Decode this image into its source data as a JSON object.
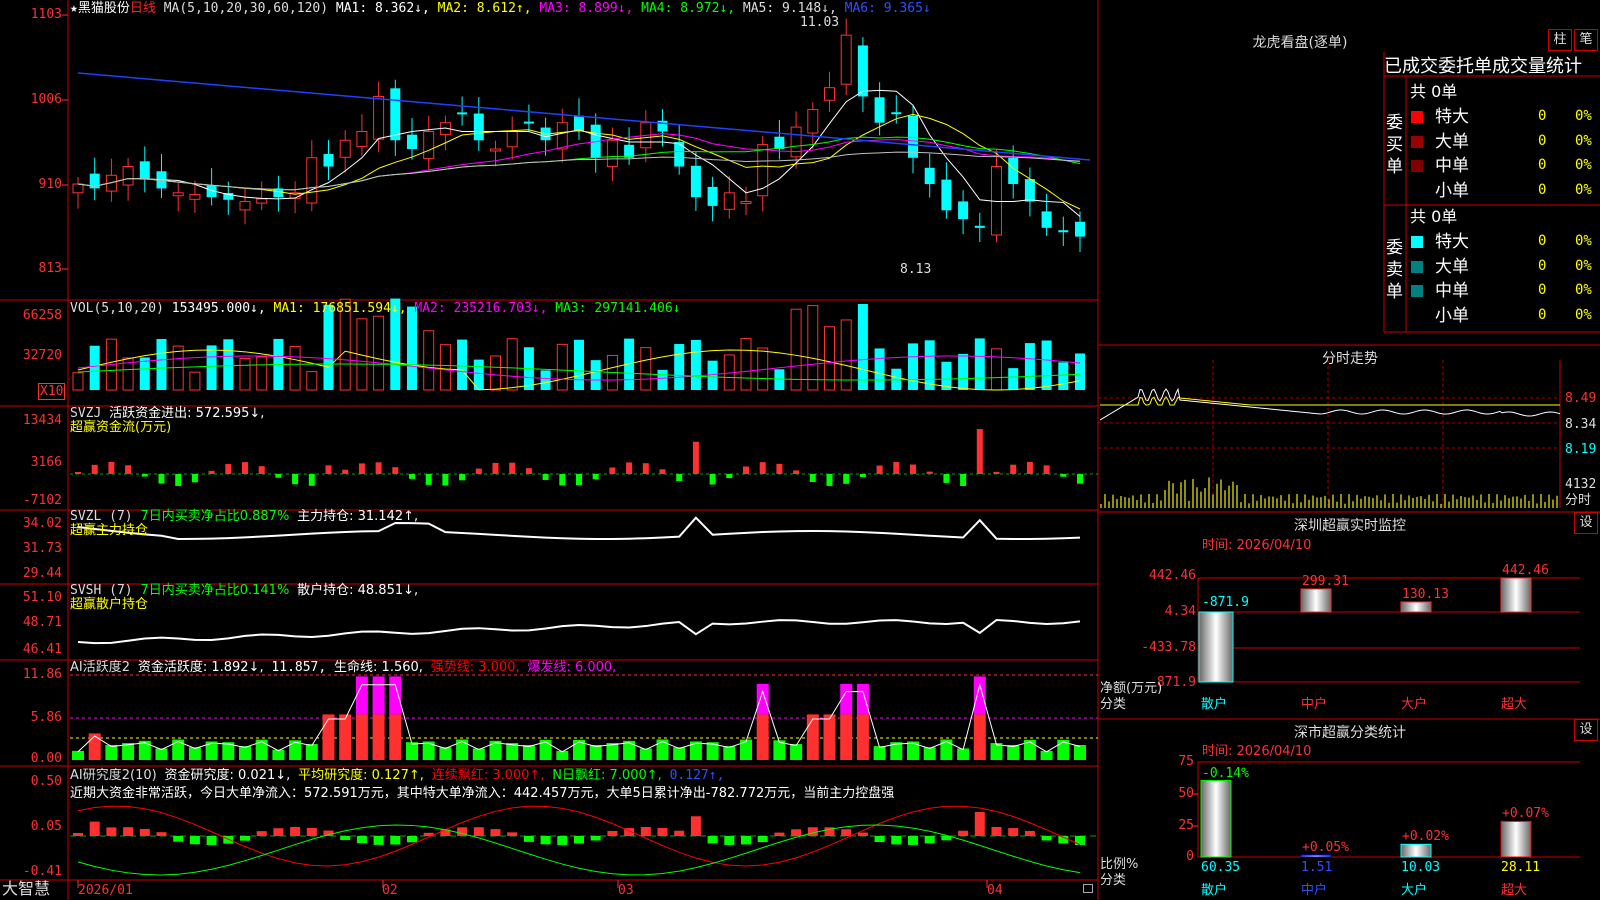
{
  "header": {
    "star": "★",
    "stock_name": "黑猫股份",
    "period": "日线",
    "ma_label": "MA(5,10,20,30,60,120)",
    "ma1": "MA1: 8.362↓,",
    "ma2": "MA2: 8.612↑,",
    "ma3": "MA3: 8.899↓,",
    "ma4": "MA4: 8.972↓,",
    "ma5": "MA5: 9.148↓,",
    "ma6": "MA6: 9.365↓"
  },
  "price_axis": [
    "1103",
    "1006",
    "910",
    "813"
  ],
  "price_marks": {
    "high": "11.03",
    "low": "8.13"
  },
  "vol": {
    "label": "VOL(5,10,20)",
    "value": "153495.000↓,",
    "ma1": "MA1: 176851.594↓,",
    "ma2": "MA2: 235216.703↓,",
    "ma3": "MA3: 297141.406↓",
    "axis": [
      "66258",
      "32720"
    ],
    "unit": "X10"
  },
  "svzj": {
    "label": "SVZJ",
    "value": "活跃资金进出: 572.595↓,",
    "sub": "超赢资金流(万元)",
    "axis": [
      "13434",
      "3166",
      "-7102"
    ]
  },
  "svzl": {
    "label": "SVZL (7)",
    "value": "7日内买卖净占比0.887%",
    "hold": "主力持仓: 31.142↑,",
    "sub": "超赢主力持仓",
    "axis": [
      "34.02",
      "31.73",
      "29.44"
    ]
  },
  "svsh": {
    "label": "SVSH (7)",
    "value": "7日内买卖净占比0.141%",
    "hold": "散户持仓: 48.851↓,",
    "sub": "超赢散户持仓",
    "axis": [
      "51.10",
      "48.71",
      "46.41"
    ]
  },
  "ai_active": {
    "label": "AI活跃度2",
    "v1": "资金活跃度: 1.892↓,",
    "v2": "11.857,",
    "v3": "生命线: 1.560,",
    "v4": "强势线: 3.000,",
    "v5": "爆发线: 6.000,",
    "axis": [
      "11.86",
      "5.86",
      "0.00"
    ]
  },
  "ai_research": {
    "label": "AI研究度2(10)",
    "v1": "资金研究度: 0.021↓,",
    "v2": "平均研究度: 0.127↑,",
    "v3": "连续飘红: 3.000↑,",
    "v4": "N日飘红: 7.000↑,",
    "v5": "0.127↑,",
    "comment": "近期大资金非常活跃，今日大单净流入：572.591万元，其中特大单净流入：442.457万元，大单5日累计净出-782.772万元，当前主力控盘强",
    "axis": [
      "0.50",
      "0.05",
      "-0.41"
    ]
  },
  "bottom": {
    "brand": "大智慧",
    "dates": [
      "2026/01",
      "02",
      "03",
      "04"
    ]
  },
  "sidebar": {
    "dragon_title": "龙虎看盘(逐单)",
    "btn_pillar": "柱",
    "btn_pen": "笔",
    "stat_title": "已成交委托单成交量统计",
    "buy_total": "共 0单",
    "buy_side": "委买单",
    "sell_total": "共 0单",
    "sell_side": "委卖单",
    "rows_buy": [
      {
        "name": "特大",
        "qty": "0",
        "pct": "0%",
        "color": "#ff0000"
      },
      {
        "name": "大单",
        "qty": "0",
        "pct": "0%",
        "color": "#990000"
      },
      {
        "name": "中单",
        "qty": "0",
        "pct": "0%",
        "color": "#800000"
      },
      {
        "name": "小单",
        "qty": "0",
        "pct": "0%",
        "color": ""
      }
    ],
    "rows_sell": [
      {
        "name": "特大",
        "qty": "0",
        "pct": "0%",
        "color": "#00ffff"
      },
      {
        "name": "大单",
        "qty": "0",
        "pct": "0%",
        "color": "#008080"
      },
      {
        "name": "中单",
        "qty": "0",
        "pct": "0%",
        "color": "#008080"
      },
      {
        "name": "小单",
        "qty": "0",
        "pct": "0%",
        "color": ""
      }
    ],
    "timeshare_title": "分时走势",
    "timeshare_axis": [
      "8.49",
      "8.34",
      "8.19"
    ],
    "timeshare_vol": "4132",
    "timeshare_unit": "分时",
    "monitor_title": "深圳超赢实时监控",
    "monitor_btn": "设",
    "monitor_time": "时间: 2026/04/10",
    "monitor_axis": [
      "442.46",
      "4.34",
      "-433.78",
      "-871.9"
    ],
    "monitor_bars": [
      {
        "cat": "散户",
        "label": "-871.9",
        "value": -871.9
      },
      {
        "cat": "中户",
        "label": "299.31",
        "value": 299.31
      },
      {
        "cat": "大户",
        "label": "130.13",
        "value": 130.13
      },
      {
        "cat": "超大",
        "label": "442.46",
        "value": 442.46
      }
    ],
    "monitor_ylabel": "净额(万元)",
    "monitor_xlabel": "分类",
    "class_title": "深市超赢分类统计",
    "class_btn": "设",
    "class_time": "时间: 2026/04/10",
    "class_axis": [
      "75",
      "50",
      "25",
      "0"
    ],
    "class_bars": [
      {
        "cat": "散户",
        "top": "-0.14%",
        "bottom": "60.35",
        "value": 60.35,
        "color": "#00ff00"
      },
      {
        "cat": "中户",
        "top": "+0.05%",
        "bottom": "1.51",
        "value": 1.51,
        "color": "#0000ff"
      },
      {
        "cat": "大户",
        "top": "+0.02%",
        "bottom": "10.03",
        "value": 10.03,
        "color": "#00ffff"
      },
      {
        "cat": "超大",
        "top": "+0.07%",
        "bottom": "28.11",
        "value": 28.11,
        "color": "#ff0000"
      }
    ],
    "class_ylabel": "比例%",
    "class_xlabel": "分类"
  }
}
